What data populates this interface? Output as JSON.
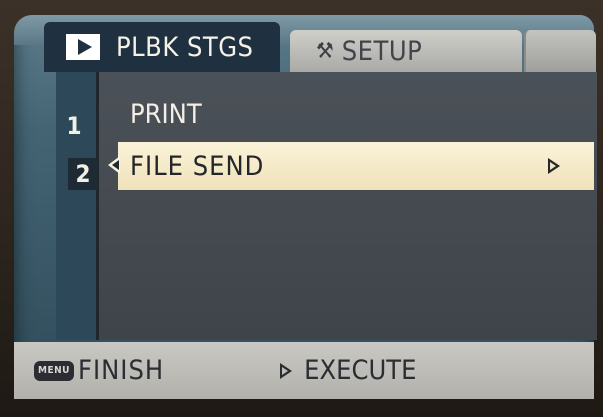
{
  "tabs": [
    {
      "label": "PLBK STGS",
      "icon": "play-icon",
      "active": true
    },
    {
      "label": "SETUP",
      "icon": "wrench-icon",
      "active": false
    }
  ],
  "menu": {
    "items": [
      {
        "index": "1",
        "label": "PRINT",
        "selected": false
      },
      {
        "index": "2",
        "label": "FILE SEND",
        "selected": true
      }
    ]
  },
  "footer": {
    "menu_key": "MENU",
    "finish_label": "FINISH",
    "execute_label": "EXECUTE"
  },
  "colors": {
    "tab_active_bg": "#1f3140",
    "selection_bg": "#fbf3d9",
    "panel_bg": "#4b5158",
    "footer_bg": "#c9c8c2"
  }
}
